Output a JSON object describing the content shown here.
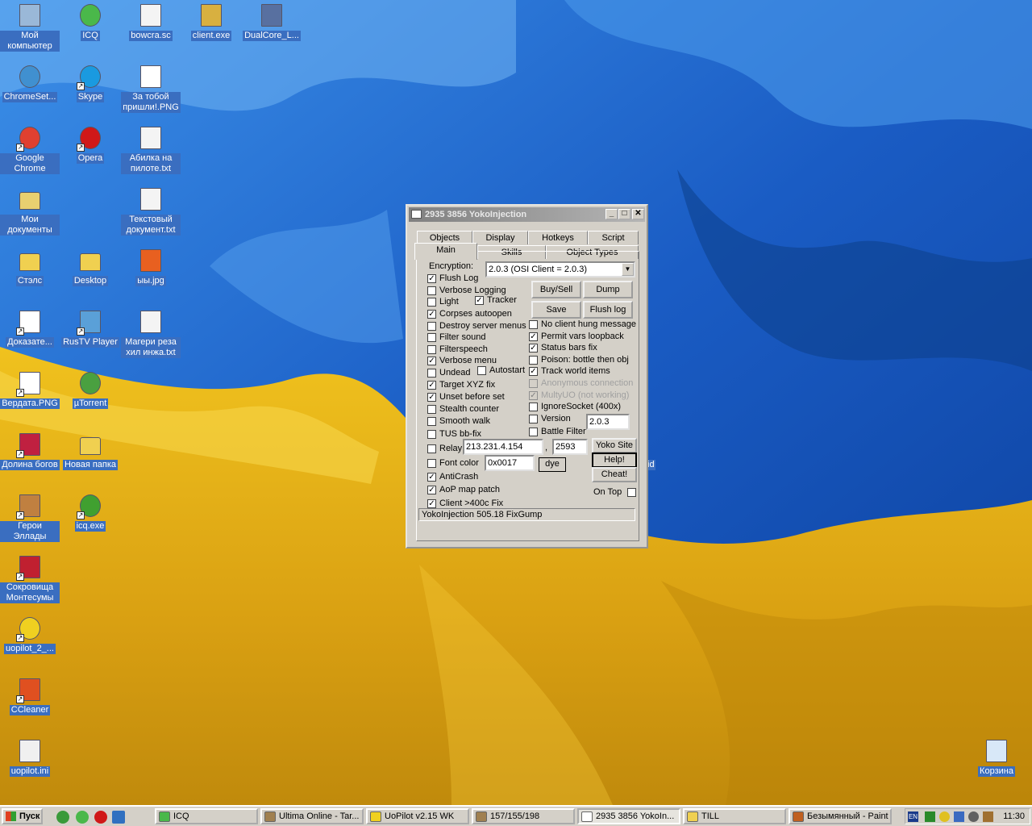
{
  "desktop": {
    "icons": [
      {
        "label": "Мой компьютер"
      },
      {
        "label": "ICQ"
      },
      {
        "label": "bowcra.sc"
      },
      {
        "label": "client.exe"
      },
      {
        "label": "DualCore_L..."
      },
      {
        "label": "ChromeSet..."
      },
      {
        "label": "Skype"
      },
      {
        "label": "За тобой пришли!.PNG"
      },
      {
        "label": "Google Chrome"
      },
      {
        "label": "Opera"
      },
      {
        "label": "Абилка на пилоте.txt"
      },
      {
        "label": "Мои документы"
      },
      {
        "label": "Текстовый документ.txt"
      },
      {
        "label": "Стэлс"
      },
      {
        "label": "Desktop"
      },
      {
        "label": "ыы.jpg"
      },
      {
        "label": "Доказате..."
      },
      {
        "label": "RusTV Player"
      },
      {
        "label": "Магери реза хил инжа.txt"
      },
      {
        "label": "Вердата.PNG"
      },
      {
        "label": "µTorrent"
      },
      {
        "label": "Долина богов"
      },
      {
        "label": "Новая папка"
      },
      {
        "label": "Герои Эллады"
      },
      {
        "label": "icq.exe"
      },
      {
        "label": "Сокровища Монтесумы"
      },
      {
        "label": "uopilot_2_..."
      },
      {
        "label": "CCleaner"
      },
      {
        "label": "uopilot.ini"
      },
      {
        "label": "Корзина"
      }
    ],
    "hidden_label_fragment": "id"
  },
  "window": {
    "title": "2935 3856 YokoInjection",
    "tabs_row1": [
      "Objects",
      "Display",
      "Hotkeys",
      "Script"
    ],
    "tabs_row2": [
      "Main",
      "Skills",
      "Object Types"
    ],
    "encryption_label": "Encryption:",
    "encryption_value": "2.0.3 (OSI Client = 2.0.3)",
    "left_options": [
      {
        "label": "Flush Log",
        "checked": true
      },
      {
        "label": "Verbose Logging",
        "checked": false
      },
      {
        "label": "Light",
        "checked": false
      },
      {
        "label": "Corpses autoopen",
        "checked": true
      },
      {
        "label": "Destroy server menus",
        "checked": false
      },
      {
        "label": "Filter sound",
        "checked": false
      },
      {
        "label": "Filterspeech",
        "checked": false
      },
      {
        "label": "Verbose menu",
        "checked": true
      },
      {
        "label": "Undead",
        "checked": false
      },
      {
        "label": "Target XYZ fix",
        "checked": true
      },
      {
        "label": "Unset before set",
        "checked": true
      },
      {
        "label": "Stealth counter",
        "checked": false
      },
      {
        "label": "Smooth walk",
        "checked": false
      },
      {
        "label": "TUS bb-fix",
        "checked": false
      },
      {
        "label": "Relay",
        "checked": false
      },
      {
        "label": "Font color",
        "checked": false
      },
      {
        "label": "AntiCrash",
        "checked": true
      },
      {
        "label": "AoP map patch",
        "checked": true
      },
      {
        "label": "Client >400c Fix",
        "checked": true
      }
    ],
    "tracker": {
      "label": "Tracker",
      "checked": true
    },
    "autostart": {
      "label": "Autostart",
      "checked": false
    },
    "right_options": [
      {
        "label": "No client hung message",
        "checked": false,
        "disabled": false
      },
      {
        "label": "Permit vars loopback",
        "checked": true,
        "disabled": false
      },
      {
        "label": "Status bars fix",
        "checked": true,
        "disabled": false
      },
      {
        "label": "Poison: bottle then obj",
        "checked": false,
        "disabled": false
      },
      {
        "label": "Track world items",
        "checked": true,
        "disabled": false
      },
      {
        "label": "Anonymous connection",
        "checked": false,
        "disabled": true
      },
      {
        "label": "MultyUO (not working)",
        "checked": true,
        "disabled": true
      },
      {
        "label": "IgnoreSocket (400x)",
        "checked": false,
        "disabled": false
      },
      {
        "label": "Version",
        "checked": false,
        "disabled": false
      },
      {
        "label": "Battle Filter",
        "checked": false,
        "disabled": false
      }
    ],
    "buttons": {
      "buysell": "Buy/Sell",
      "dump": "Dump",
      "save": "Save",
      "flushlog": "Flush log",
      "yokosite": "Yoko Site",
      "help": "Help!",
      "cheat": "Cheat!",
      "dye": "dye"
    },
    "version_value": "2.0.3",
    "relay_ip": "213.231.4.154",
    "relay_sep": ",",
    "relay_port": "2593",
    "font_color_value": "0x0017",
    "ontop_label": "On Top",
    "ontop_checked": false,
    "status": "YokoInjection 505.18 FixGump"
  },
  "taskbar": {
    "start": "Пуск",
    "tasks": [
      {
        "label": "ICQ",
        "active": false
      },
      {
        "label": "Ultima Online - Tar...",
        "active": false
      },
      {
        "label": "UoPilot  v2.15   WK",
        "active": false
      },
      {
        "label": "157/155/198",
        "active": false
      },
      {
        "label": "2935 3856 YokoIn...",
        "active": true
      },
      {
        "label": "TILL",
        "active": false
      },
      {
        "label": "Безымянный - Paint",
        "active": false
      }
    ],
    "lang": "EN",
    "clock": "11:30"
  },
  "colors": {
    "desktop_blue": "#1f64c8",
    "desktop_yellow": "#e8b21a",
    "titlebar_inactive": "#808080",
    "face": "#d4d0c8"
  }
}
